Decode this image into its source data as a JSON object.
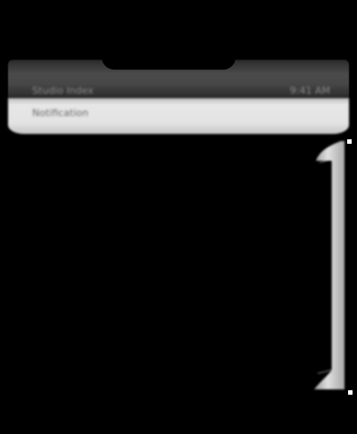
{
  "colors": {
    "background": "#000000",
    "status_bar": "#474747",
    "header_band": "#e3e3e3",
    "rail": "#d9d9d9"
  },
  "status_bar": {
    "left_text": "Studio Index",
    "right_text": "9:41 AM"
  },
  "header": {
    "text": "Notification"
  },
  "icons": {
    "scroll_rail": "vertical-scroll-rail-icon"
  }
}
